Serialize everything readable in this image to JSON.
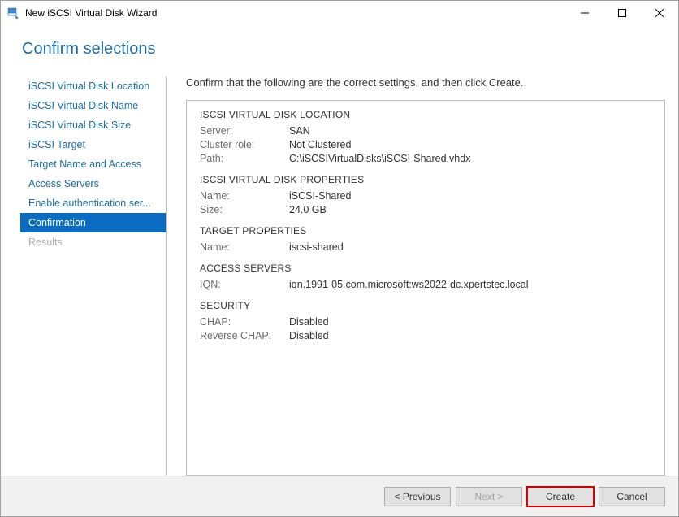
{
  "window": {
    "title": "New iSCSI Virtual Disk Wizard"
  },
  "header": {
    "title": "Confirm selections"
  },
  "sidebar": {
    "steps": [
      {
        "label": "iSCSI Virtual Disk Location"
      },
      {
        "label": "iSCSI Virtual Disk Name"
      },
      {
        "label": "iSCSI Virtual Disk Size"
      },
      {
        "label": "iSCSI Target"
      },
      {
        "label": "Target Name and Access"
      },
      {
        "label": "Access Servers"
      },
      {
        "label": "Enable authentication ser..."
      },
      {
        "label": "Confirmation"
      },
      {
        "label": "Results"
      }
    ]
  },
  "content": {
    "instruction": "Confirm that the following are the correct settings, and then click Create.",
    "sections": {
      "location": {
        "title": "ISCSI VIRTUAL DISK LOCATION",
        "server_label": "Server:",
        "server_value": "SAN",
        "cluster_label": "Cluster role:",
        "cluster_value": "Not Clustered",
        "path_label": "Path:",
        "path_value": "C:\\iSCSIVirtualDisks\\iSCSI-Shared.vhdx"
      },
      "properties": {
        "title": "ISCSI VIRTUAL DISK PROPERTIES",
        "name_label": "Name:",
        "name_value": "iSCSI-Shared",
        "size_label": "Size:",
        "size_value": "24.0 GB"
      },
      "target": {
        "title": "TARGET PROPERTIES",
        "name_label": "Name:",
        "name_value": "iscsi-shared"
      },
      "access": {
        "title": "ACCESS SERVERS",
        "iqn_label": "IQN:",
        "iqn_value": "iqn.1991-05.com.microsoft:ws2022-dc.xpertstec.local"
      },
      "security": {
        "title": "SECURITY",
        "chap_label": "CHAP:",
        "chap_value": "Disabled",
        "rchap_label": "Reverse CHAP:",
        "rchap_value": "Disabled"
      }
    }
  },
  "footer": {
    "previous": "< Previous",
    "next": "Next >",
    "create": "Create",
    "cancel": "Cancel"
  }
}
